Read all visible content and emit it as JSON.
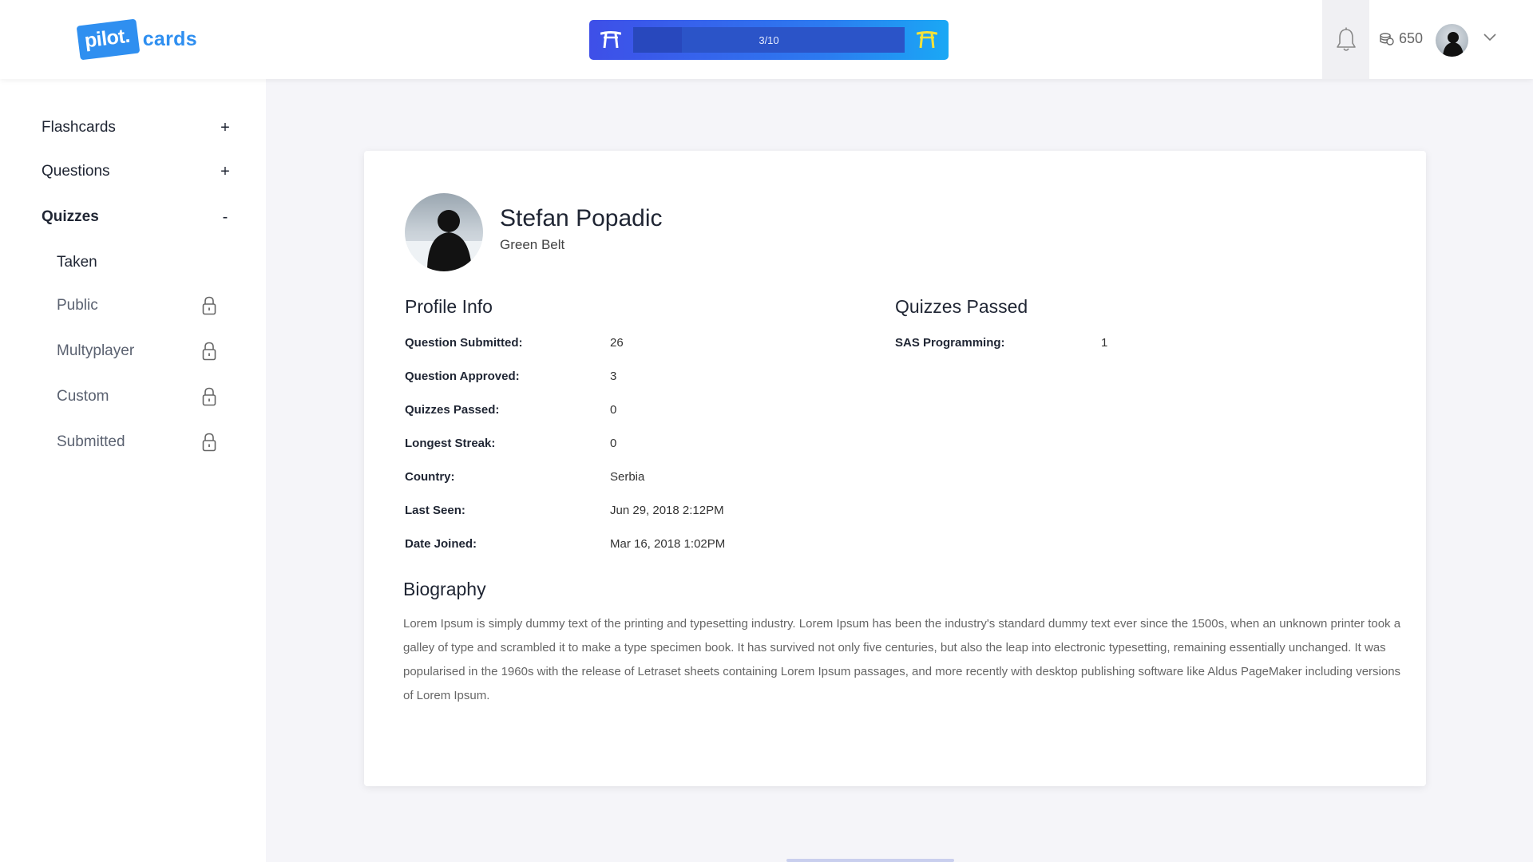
{
  "app": {
    "logo_badge": "pilot.",
    "logo_text": "cards"
  },
  "header": {
    "progress": {
      "label": "3/10",
      "fraction": 0.18
    },
    "coins": "650",
    "colors": {
      "progress_start": "#3e4fe8",
      "progress_end": "#1aa8f5",
      "accent": "#2f8ff0"
    }
  },
  "sidebar": {
    "flashcards": {
      "label": "Flashcards",
      "toggle": "+"
    },
    "questions": {
      "label": "Questions",
      "toggle": "+"
    },
    "quizzes": {
      "label": "Quizzes",
      "toggle": "-"
    },
    "sub_items": [
      {
        "label": "Taken",
        "locked": false
      },
      {
        "label": "Public",
        "locked": true,
        "icon": "lock-icon"
      },
      {
        "label": "Multyplayer",
        "locked": true,
        "icon": "lock-icon"
      },
      {
        "label": "Custom",
        "locked": true,
        "icon": "lock-icon"
      },
      {
        "label": "Submitted",
        "locked": true,
        "icon": "lock-icon"
      }
    ]
  },
  "profile": {
    "name": "Stefan Popadic",
    "belt": "Green Belt",
    "info_title": "Profile Info",
    "info": [
      {
        "key": "Question Submitted:",
        "value": "26"
      },
      {
        "key": "Question Approved:",
        "value": "3"
      },
      {
        "key": "Quizzes Passed:",
        "value": "0"
      },
      {
        "key": "Longest Streak:",
        "value": "0"
      },
      {
        "key": "Country:",
        "value": "Serbia"
      },
      {
        "key": "Last Seen:",
        "value": "Jun 29, 2018 2:12PM"
      },
      {
        "key": "Date Joined:",
        "value": "Mar 16, 2018 1:02PM"
      }
    ],
    "quizzes_title": "Quizzes Passed",
    "quizzes": [
      {
        "key": "SAS Programming:",
        "value": "1"
      }
    ],
    "bio_title": "Biography",
    "bio": "Lorem Ipsum is simply dummy text of the printing and typesetting industry. Lorem Ipsum has been the industry's standard dummy text ever since the 1500s, when an unknown printer took a galley of type and scrambled it to make a type specimen book. It has survived not only five centuries, but also the leap into electronic typesetting, remaining essentially unchanged. It was popularised in the 1960s with the release of Letraset sheets containing Lorem Ipsum passages, and more recently with desktop publishing software like Aldus PageMaker including versions of Lorem Ipsum."
  }
}
